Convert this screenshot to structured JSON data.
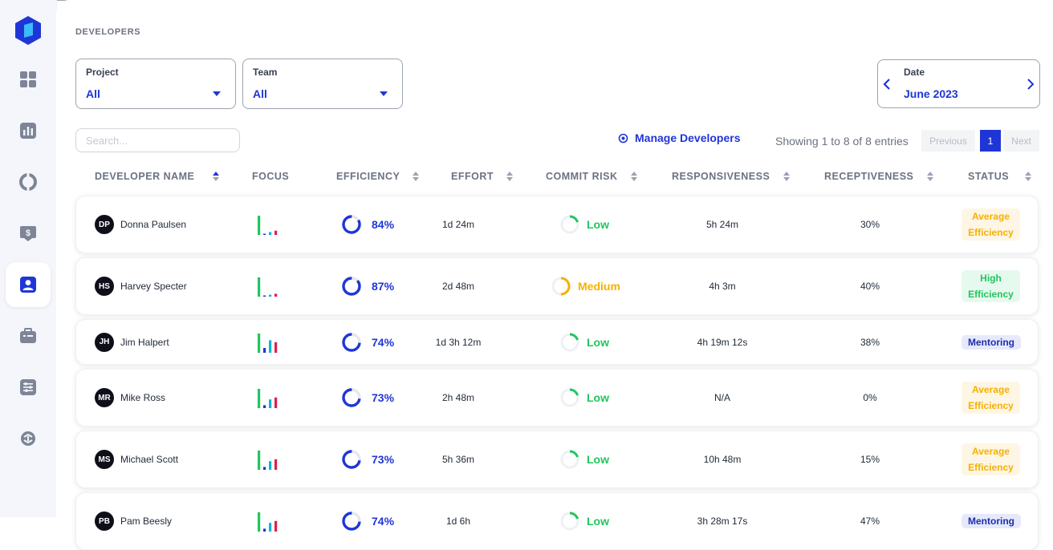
{
  "page": {
    "title": "DEVELOPERS"
  },
  "filters": {
    "project": {
      "label": "Project",
      "value": "All"
    },
    "team": {
      "label": "Team",
      "value": "All"
    },
    "date": {
      "label": "Date",
      "value": "June 2023"
    }
  },
  "search": {
    "placeholder": "Search..."
  },
  "manage": {
    "label": "Manage Developers"
  },
  "pagination": {
    "showing": "Showing 1 to 8 of 8 entries",
    "previous": "Previous",
    "page": "1",
    "next": "Next"
  },
  "columns": [
    "DEVELOPER NAME",
    "FOCUS",
    "EFFICIENCY",
    "EFFORT",
    "COMMIT RISK",
    "RESPONSIVENESS",
    "RECEPTIVENESS",
    "STATUS"
  ],
  "colors": {
    "accent": "#1f36d6",
    "low": "#22c55e",
    "medium": "#f5b100",
    "focus_green": "#22c55e",
    "focus_teal": "#06b6d4",
    "focus_blue": "#1f36d6",
    "focus_red": "#e11d48"
  },
  "rows": [
    {
      "initials": "DP",
      "name": "Donna Paulsen",
      "focus": [
        1.0,
        0.06,
        0.15,
        0.22
      ],
      "efficiency": 84,
      "efficiency_label": "84%",
      "effort": "1d 24m",
      "risk": "Low",
      "risk_level": "low",
      "responsiveness": "5h 24m",
      "receptiveness": "30%",
      "status": [
        "Average",
        "Efficiency"
      ],
      "status_kind": "avg"
    },
    {
      "initials": "HS",
      "name": "Harvey Specter",
      "focus": [
        1.0,
        0.06,
        0.1,
        0.15
      ],
      "efficiency": 87,
      "efficiency_label": "87%",
      "effort": "2d 48m",
      "risk": "Medium",
      "risk_level": "medium",
      "responsiveness": "4h 3m",
      "receptiveness": "40%",
      "status": [
        "High",
        "Efficiency"
      ],
      "status_kind": "high"
    },
    {
      "initials": "JH",
      "name": "Jim Halpert",
      "focus": [
        1.0,
        0.25,
        0.65,
        0.55
      ],
      "efficiency": 74,
      "efficiency_label": "74%",
      "effort": "1d 3h 12m",
      "risk": "Low",
      "risk_level": "low",
      "responsiveness": "4h 19m 12s",
      "receptiveness": "38%",
      "status": [
        "Mentoring"
      ],
      "status_kind": "ment"
    },
    {
      "initials": "MR",
      "name": "Mike Ross",
      "focus": [
        1.0,
        0.15,
        0.45,
        0.55
      ],
      "efficiency": 73,
      "efficiency_label": "73%",
      "effort": "2h 48m",
      "risk": "Low",
      "risk_level": "low",
      "responsiveness": "N/A",
      "receptiveness": "0%",
      "status": [
        "Average",
        "Efficiency"
      ],
      "status_kind": "avg"
    },
    {
      "initials": "MS",
      "name": "Michael Scott",
      "focus": [
        1.0,
        0.15,
        0.45,
        0.55
      ],
      "efficiency": 73,
      "efficiency_label": "73%",
      "effort": "5h 36m",
      "risk": "Low",
      "risk_level": "low",
      "responsiveness": "10h 48m",
      "receptiveness": "15%",
      "status": [
        "Average",
        "Efficiency"
      ],
      "status_kind": "avg"
    },
    {
      "initials": "PB",
      "name": "Pam Beesly",
      "focus": [
        1.0,
        0.15,
        0.45,
        0.55
      ],
      "efficiency": 74,
      "efficiency_label": "74%",
      "effort": "1d 6h",
      "risk": "Low",
      "risk_level": "low",
      "responsiveness": "3h 28m 17s",
      "receptiveness": "47%",
      "status": [
        "Mentoring"
      ],
      "status_kind": "ment"
    }
  ]
}
